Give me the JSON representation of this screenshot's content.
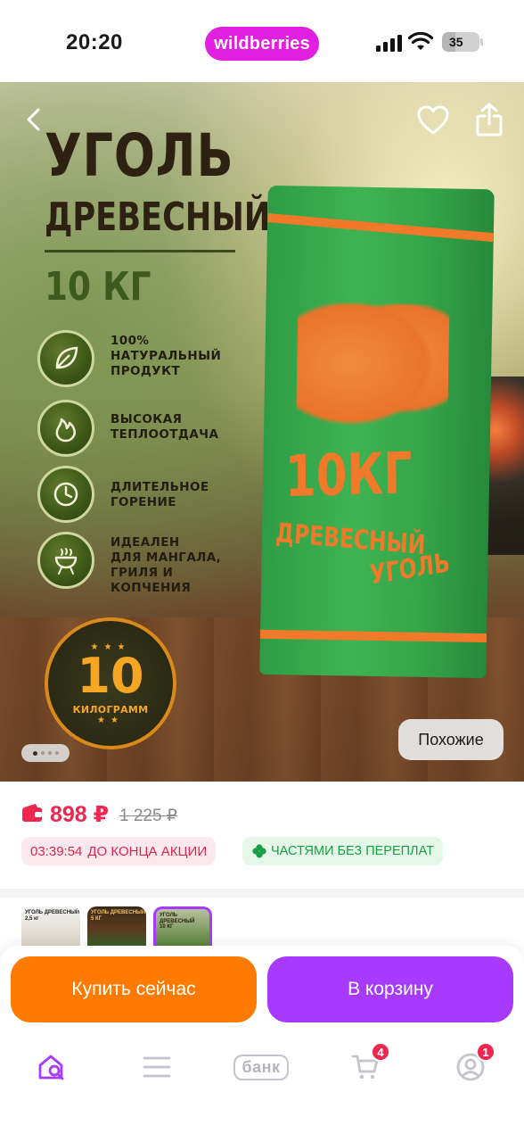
{
  "status_bar": {
    "time": "20:20",
    "brand": "wildberries",
    "battery": "35",
    "battery_level_percent": 35,
    "icons": [
      "signal-icon",
      "wifi-icon",
      "battery-icon"
    ]
  },
  "product_image": {
    "title_line1": "УГОЛЬ",
    "title_line2": "ДРЕВЕСНЫЙ",
    "title_weight": "10 КГ",
    "features": [
      {
        "icon": "leaf-icon",
        "text": "100%\nНАТУРАЛЬНЫЙ\nПРОДУКТ"
      },
      {
        "icon": "flame-icon",
        "text": "ВЫСОКАЯ\nТЕПЛООТДАЧА"
      },
      {
        "icon": "clock-icon",
        "text": "ДЛИТЕЛЬНОЕ\nГОРЕНИЕ"
      },
      {
        "icon": "grill-icon",
        "text": "ИДЕАЛЕН\nДЛЯ МАНГАЛА,\nГРИЛЯ И\nКОПЧЕНИЯ"
      }
    ],
    "weight_badge_number": "10",
    "weight_badge_unit": "КИЛОГРАММ",
    "bag_weight": "10КГ",
    "bag_line1": "ДРЕВЕСНЫЙ",
    "bag_line2": "УГОЛЬ",
    "page_indicator": {
      "total": 4,
      "active": 1
    },
    "similar_label": "Похожие"
  },
  "price": {
    "current": "898 ₽",
    "old": "1 225 ₽",
    "promo_timer": "03:39:54",
    "promo_text": "ДО КОНЦА АКЦИИ",
    "installment_text": "ЧАСТЯМИ БЕЗ ПЕРЕПЛАТ",
    "accent_color": "#f0264f",
    "installment_color": "#1a9e44"
  },
  "variants": [
    {
      "label": "УГОЛЬ ДРЕВЕСНЫЙ\n2,5 кг",
      "selected": false
    },
    {
      "label": "УГОЛЬ ДРЕВЕСНЫЙ 5 КГ",
      "selected": false
    },
    {
      "label": "УГОЛЬ\nДРЕВЕСНЫЙ\n10 КГ",
      "selected": true
    }
  ],
  "actions": {
    "buy_now": "Купить сейчас",
    "add_to_cart": "В корзину",
    "buy_color": "#ff7a00",
    "cart_color": "#a73afd"
  },
  "tab_bar": {
    "tabs": [
      {
        "name": "home",
        "icon": "home-search-icon",
        "active": true
      },
      {
        "name": "catalog",
        "icon": "menu-icon"
      },
      {
        "name": "bank",
        "label": "банк"
      },
      {
        "name": "cart",
        "icon": "cart-icon",
        "badge": "4"
      },
      {
        "name": "profile",
        "icon": "profile-icon",
        "badge": "1"
      }
    ]
  }
}
